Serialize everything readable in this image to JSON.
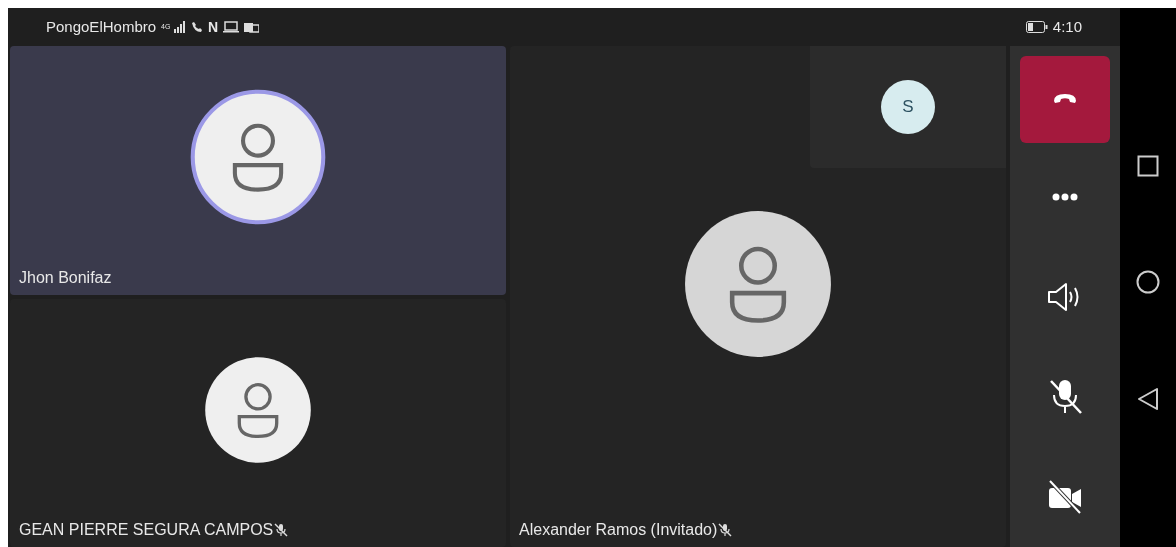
{
  "status_bar": {
    "carrier": "PongoElHombro",
    "network": "4G",
    "app_letter": "N",
    "time": "4:10"
  },
  "left_column": [
    {
      "name": "Jhon Bonifaz",
      "speaking": true,
      "muted": false
    },
    {
      "name": "GEAN PIERRE SEGURA CAMPOS",
      "speaking": false,
      "muted": true
    }
  ],
  "main_participant": {
    "name": "Alexander Ramos (Invitado)",
    "speaking": false,
    "muted": true
  },
  "self_preview": {
    "initial": "S"
  },
  "controls": [
    {
      "kind": "hangup"
    },
    {
      "kind": "more"
    },
    {
      "kind": "speaker"
    },
    {
      "kind": "mic-off"
    },
    {
      "kind": "camera-off"
    }
  ],
  "nav_buttons": [
    {
      "kind": "recents"
    },
    {
      "kind": "home"
    },
    {
      "kind": "back"
    }
  ]
}
